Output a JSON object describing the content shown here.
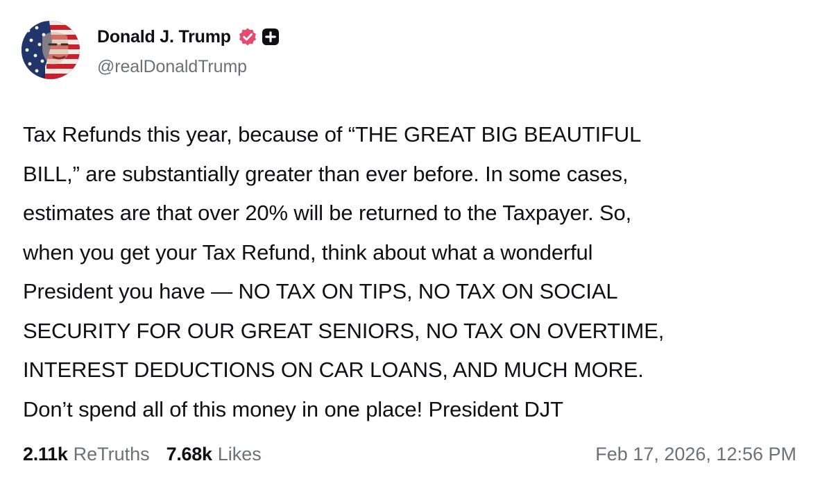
{
  "post": {
    "author": {
      "display_name": "Donald J. Trump",
      "handle": "@realDonaldTrump",
      "verified_badge_icon": "verified-badge-icon",
      "plus_badge_icon": "plus-badge-icon",
      "verified_color": "#e64a6e"
    },
    "body_lines": [
      "Tax Refunds this year, because of “THE GREAT BIG BEAUTIFUL",
      "BILL,” are substantially greater than ever before. In some cases,",
      "estimates are that over 20% will be returned to the Taxpayer. So,",
      "when you get your Tax Refund, think about what a wonderful",
      "President you have — NO TAX ON TIPS, NO TAX ON SOCIAL",
      "SECURITY FOR OUR GREAT SENIORS, NO TAX ON OVERTIME,",
      "INTEREST DEDUCTIONS ON CAR LOANS, AND MUCH MORE.",
      "Don’t spend all of this money in one place! President DJT"
    ],
    "stats": {
      "retruths_count": "2.11k",
      "retruths_label": "ReTruths",
      "likes_count": "7.68k",
      "likes_label": "Likes"
    },
    "timestamp": "Feb 17, 2026, 12:56 PM"
  }
}
